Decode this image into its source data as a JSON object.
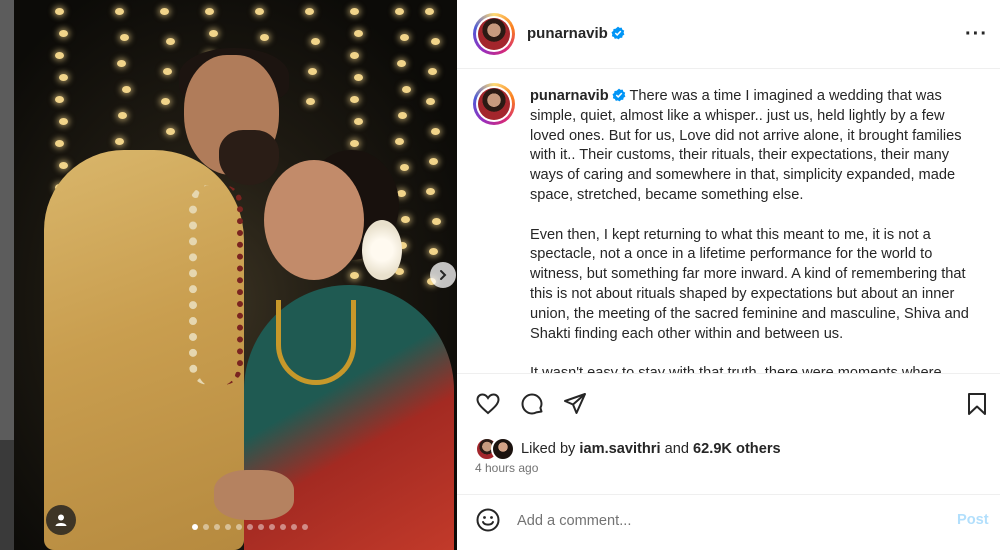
{
  "post": {
    "username": "punarnavib",
    "caption_paragraphs": [
      "There was a time I imagined a wedding that was simple, quiet, almost like a whisper.. just us, held lightly by a few loved ones. But for us, Love did not arrive alone, it brought families with it.. Their customs, their rituals, their expectations, their many ways of caring and somewhere in that, simplicity expanded, made space, stretched, became something else.",
      "Even then, I kept returning to what this meant to me, it is not a spectacle, not a once in a lifetime performance for the world to witness, but something far more inward. A kind of remembering that this is not about rituals shaped by expectations but about an inner union, the meeting of the sacred feminine and masculine, Shiva and Shakti finding each other within and between us.",
      "It wasn't easy to stay with that truth, there were moments where"
    ],
    "liked_by_prefix": "Liked by",
    "liked_by_user": "iam.savithri",
    "liked_by_connector": "and",
    "liked_by_others": "62.9K others",
    "timestamp": "4 hours ago"
  },
  "comment": {
    "placeholder": "Add a comment...",
    "post_label": "Post"
  },
  "carousel": {
    "slide_count": 11,
    "active_index": 0
  },
  "icons": {
    "more": "more-options-icon",
    "like": "heart-icon",
    "comment": "comment-icon",
    "share": "send-icon",
    "save": "bookmark-icon",
    "emoji": "emoji-icon",
    "next": "chevron-right-icon",
    "tag": "user-tag-icon",
    "verified": "verified-badge-icon"
  },
  "colors": {
    "verified": "#0095f6",
    "post_button": "#b2dffc",
    "secondary_text": "#737373"
  }
}
